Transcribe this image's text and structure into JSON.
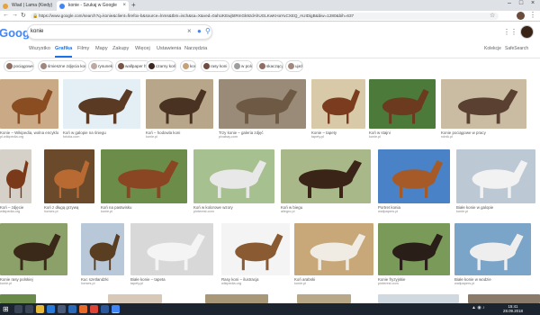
{
  "browser": {
    "tabs": [
      {
        "title": "Wiad | Lama (Kiedy)",
        "active": false
      },
      {
        "title": "konie - Szukaj w Google",
        "active": true
      }
    ],
    "url": "https://www.google.com/search?q=konie&client=firefox-b&source=lnms&tbm=isch&sa=X&ved=0ahUKEwj5tRmGk9zdAhUGLKwKHaYuCXEQ_AUIDigB&biw=1280&bih=637"
  },
  "search": {
    "logo": "Google",
    "query": "konie"
  },
  "nav_tabs": [
    "Wszystko",
    "Grafika",
    "Filmy",
    "Mapy",
    "Zakupy",
    "Więcej",
    "Ustawienia",
    "Narzędzia"
  ],
  "active_tab": "Grafika",
  "tools": [
    "Kolekcje",
    "SafeSearch"
  ],
  "chips": [
    {
      "label": "pociągowe",
      "color": "#8d6e63"
    },
    {
      "label": "śmieszne zdjęcia konie",
      "color": "#a1887f"
    },
    {
      "label": "rysunek",
      "color": "#bcaaa4"
    },
    {
      "label": "wallpaper hd",
      "color": "#795548"
    },
    {
      "label": "czarny koń",
      "color": "#3e2723"
    },
    {
      "label": "konik",
      "color": "#c7a17a"
    },
    {
      "label": "rasy koni",
      "color": "#6d4c41"
    },
    {
      "label": "w polu",
      "color": "#9e9e9e"
    },
    {
      "label": "skaczący",
      "color": "#8d6e63"
    },
    {
      "label": "ujeżdżenie",
      "color": "#a1887f"
    }
  ],
  "images_row1": [
    {
      "caption": "Konie – Wikipedia, wolna encyklopedia",
      "source": "pl.wikipedia.org",
      "bg": "#c9a986",
      "fg": "#8a4d22"
    },
    {
      "caption": "Koń w galopie na śniegu",
      "source": "fotolia.com",
      "bg": "#e4eef5",
      "fg": "#5a3a22"
    },
    {
      "caption": "Koń – hodowla koni",
      "source": "konie.pl",
      "bg": "#b8a68b",
      "fg": "#4a3222"
    },
    {
      "caption": "Trzy konie – galeria zdjęć",
      "source": "pixabay.com",
      "bg": "#9a8a78",
      "fg": "#6e5a44"
    },
    {
      "caption": "Konie – tapety",
      "source": "tapety.pl",
      "bg": "#d8c9a8",
      "fg": "#7a3b1e"
    },
    {
      "caption": "Koń w stajni",
      "source": "konie.pl",
      "bg": "#4c7a3a",
      "fg": "#6b3a1f"
    },
    {
      "caption": "Konie pociągowe w pracy",
      "source": "rolnik.pl",
      "bg": "#c9bca3",
      "fg": "#5a4030"
    }
  ],
  "images_row2": [
    {
      "caption": "Koń – zdjęcie",
      "source": "wikipedia.org",
      "bg": "#d5d0c8",
      "fg": "#7a3a1a"
    },
    {
      "caption": "Koń z długą grzywą",
      "source": "horses.pl",
      "bg": "#6a4a2a",
      "fg": "#b86a32"
    },
    {
      "caption": "Koń na pastwisku",
      "source": "konie.pl",
      "bg": "#6c8c4a",
      "fg": "#8a4522"
    },
    {
      "caption": "Koń w kolorowe wzory",
      "source": "pinterest.com",
      "bg": "#a7c090",
      "fg": "#e8e8e8"
    },
    {
      "caption": "Koń w biegu",
      "source": "allegro.pl",
      "bg": "#a8b888",
      "fg": "#3a2418"
    },
    {
      "caption": "Portret konia",
      "source": "wallpapers.pl",
      "bg": "#4a82c8",
      "fg": "#a65a28"
    },
    {
      "caption": "Białe konie w galopie",
      "source": "konie.pl",
      "bg": "#bcc8d4",
      "fg": "#f2f2f2"
    }
  ],
  "images_row3": [
    {
      "caption": "Konie rasy polskiej",
      "source": "konie.pl",
      "bg": "#8ca06a",
      "fg": "#3a2818"
    },
    {
      "caption": "Kuc szetlandzki",
      "source": "horses.pl",
      "bg": "#b8c8d8",
      "fg": "#5a3e22"
    },
    {
      "caption": "Białe konie – tapeta",
      "source": "tapety.pl",
      "bg": "#d8d8d8",
      "fg": "#f4f4f4"
    },
    {
      "caption": "Rasy koni – ilustracja",
      "source": "wikipedia.org",
      "bg": "#f4f4f4",
      "fg": "#8a5a32"
    },
    {
      "caption": "Koń arabski",
      "source": "konie.pl",
      "bg": "#c8a878",
      "fg": "#f0ece4"
    },
    {
      "caption": "Konie fryzyjskie",
      "source": "pinterest.com",
      "bg": "#7a9a5a",
      "fg": "#2a1e18"
    },
    {
      "caption": "Białe konie w wodzie",
      "source": "wallpapers.pl",
      "bg": "#7aa4c8",
      "fg": "#eeeeee"
    }
  ],
  "taskbar": {
    "time": "15:41",
    "date": "28.09.2018"
  }
}
